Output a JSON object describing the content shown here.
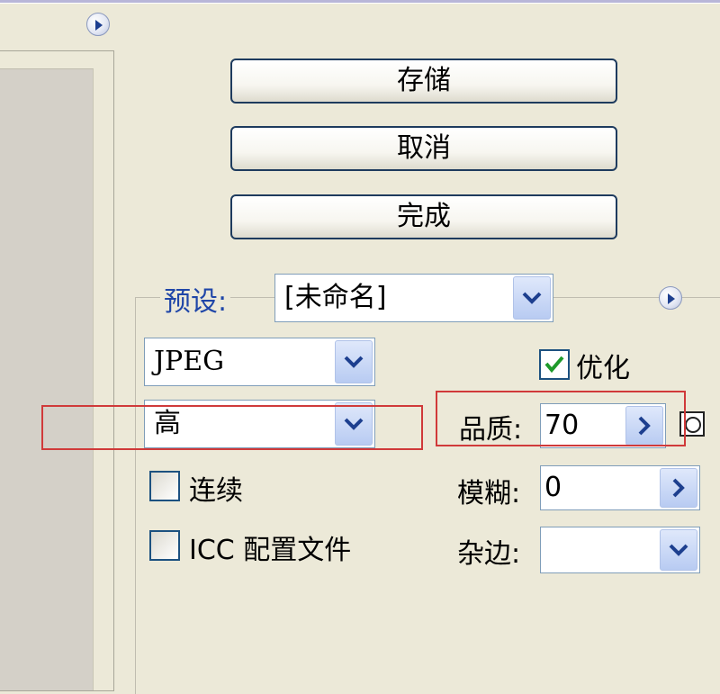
{
  "buttons": {
    "save": "存储",
    "cancel": "取消",
    "done": "完成"
  },
  "preset": {
    "label": "预设:",
    "value": "[未命名]"
  },
  "format": {
    "value": "JPEG"
  },
  "quality_preset": {
    "value": "高"
  },
  "optimize": {
    "label": "优化",
    "checked": true
  },
  "quality": {
    "label": "品质:",
    "value": "70"
  },
  "blur": {
    "label": "模糊:",
    "value": "0"
  },
  "matte": {
    "label": "杂边:",
    "value": ""
  },
  "progressive": {
    "label": "连续",
    "checked": false
  },
  "icc": {
    "label": "ICC 配置文件",
    "checked": false
  },
  "icons": [
    "menu-arrow-icon",
    "chevron-down-icon",
    "chevron-right-icon",
    "checkmark-icon",
    "circle-icon"
  ],
  "colors": {
    "accent": "#1f46a8",
    "highlight": "#d03a3a",
    "checkmark": "#1e9a2a"
  }
}
